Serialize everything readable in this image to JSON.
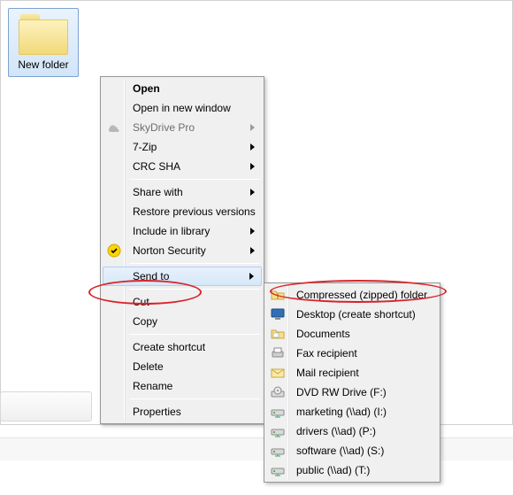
{
  "folder": {
    "label": "New folder"
  },
  "menu": {
    "open": "Open",
    "open_new": "Open in new window",
    "skydrive": "SkyDrive Pro",
    "sevenzip": "7-Zip",
    "crc": "CRC SHA",
    "share": "Share with",
    "restore": "Restore previous versions",
    "include": "Include in library",
    "norton": "Norton Security",
    "sendto": "Send to",
    "cut": "Cut",
    "copy": "Copy",
    "shortcut": "Create shortcut",
    "delete": "Delete",
    "rename": "Rename",
    "properties": "Properties"
  },
  "sendto": {
    "zip": "Compressed (zipped) folder",
    "desktop": "Desktop (create shortcut)",
    "documents": "Documents",
    "fax": "Fax recipient",
    "mail": "Mail recipient",
    "dvd": "DVD RW Drive (F:)",
    "marketing": "marketing (\\\\ad) (I:)",
    "drivers": "drivers (\\\\ad) (P:)",
    "software": "software (\\\\ad) (S:)",
    "public": "public (\\\\ad) (T:)"
  },
  "colors": {
    "highlight_border": "#aecff7",
    "annotation": "#d8232a"
  }
}
